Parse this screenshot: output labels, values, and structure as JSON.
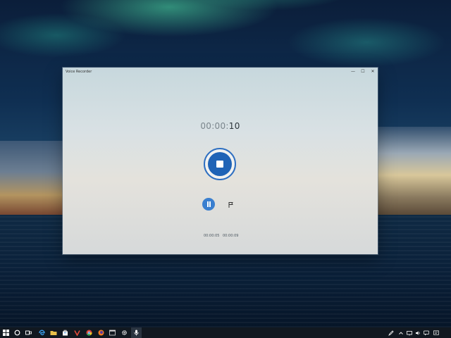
{
  "app": {
    "title": "Voice Recorder",
    "window_controls": {
      "minimize": "—",
      "maximize": "☐",
      "close": "✕"
    }
  },
  "recorder": {
    "timer_prefix": "00:00:",
    "timer_seconds": "10",
    "markers": [
      "00:00:05",
      "00:00:09"
    ]
  },
  "colors": {
    "accent": "#1f63b6",
    "accent_light": "#3a7fcf",
    "taskbar": "#111820"
  },
  "taskbar": {
    "left_icons": [
      "windows-start-icon",
      "cortana-search-icon",
      "task-view-icon",
      "edge-browser-icon",
      "file-explorer-icon",
      "store-icon",
      "vivaldi-icon",
      "chrome-icon",
      "firefox-icon",
      "terminal-icon",
      "settings-icon",
      "voice-recorder-icon"
    ],
    "tray_icons": [
      "pen-icon",
      "chevron-up-icon",
      "network-icon",
      "volume-icon",
      "speech-bubble-icon",
      "notifications-icon"
    ]
  }
}
